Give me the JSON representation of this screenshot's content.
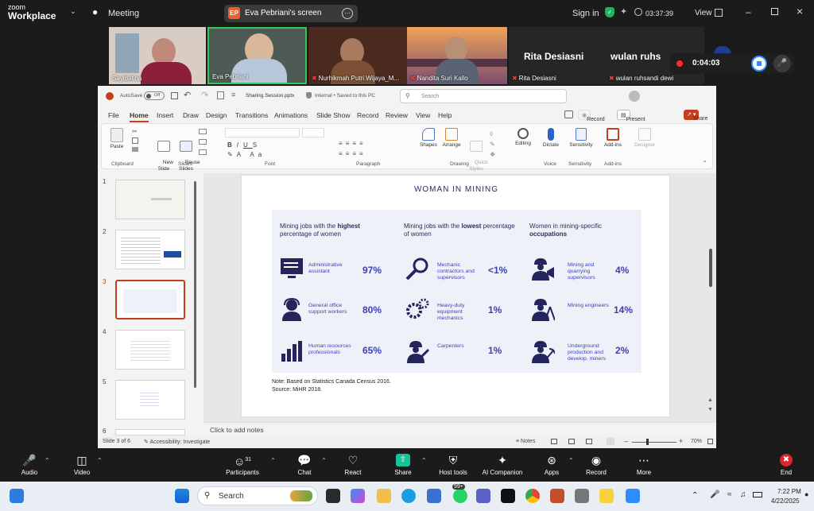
{
  "zoom": {
    "logo_line1": "zoom",
    "logo_line2": "Workplace",
    "meeting_label": "Meeting",
    "screen_badge": "EP",
    "screen_title": "Eva Pebriani's screen",
    "sign_in": "Sign in",
    "clock": "03:37:39",
    "view_label": "View",
    "recording_time": "0:04:03"
  },
  "participants": [
    {
      "name": "Sayidatina",
      "muted": false
    },
    {
      "name": "Eva Pebriani",
      "muted": false
    },
    {
      "name": "Nurhikmah Putri Wijaya_M...",
      "muted": true
    },
    {
      "name": "Nandita Suri Kallo",
      "muted": true
    },
    {
      "name": "Rita Desiasni",
      "muted": true,
      "big_label": "Rita Desiasni"
    },
    {
      "name": "wulan ruhsandi dewi",
      "muted": true,
      "big_label": "wulan  ruhs"
    }
  ],
  "ppt": {
    "autosave": "AutoSave",
    "autosave_state": "Off",
    "file_name": "Sharing Session.pptx",
    "file_status": "Internal • Saved to this PC",
    "search_placeholder": "Search",
    "menu": [
      "File",
      "Home",
      "Insert",
      "Draw",
      "Design",
      "Transitions",
      "Animations",
      "Slide Show",
      "Record",
      "Review",
      "View",
      "Help"
    ],
    "record_btn": "Record",
    "present_btn": "Present in Teams",
    "share_btn": "Share",
    "ribbon": {
      "paste": "Paste",
      "new_slide": "New\nSlide",
      "reuse_slides": "Reuse\nSlides",
      "shapes": "Shapes",
      "arrange": "Arrange",
      "quick_styles": "Quick\nStyles",
      "editing": "Editing",
      "dictate": "Dictate",
      "sensitivity": "Sensitivity",
      "add_ins": "Add-ins",
      "designer": "Designer",
      "groups": [
        "Clipboard",
        "Slides",
        "Font",
        "Paragraph",
        "Drawing",
        "Voice",
        "Sensitivity",
        "Add-ins"
      ]
    },
    "thumb_numbers": [
      "1",
      "2",
      "3",
      "4",
      "5",
      "6"
    ],
    "active_slide": 3,
    "notes_placeholder": "Click to add notes",
    "status_slide": "Slide 3 of 6",
    "status_accessibility": "Accessibility: Investigate",
    "status_notes": "Notes",
    "zoom_level": "70%"
  },
  "slide": {
    "title": "WOMAN IN MINING",
    "columns": [
      {
        "head_pre": "Mining jobs with the ",
        "head_bold": "highest",
        "head_post": " percentage of women",
        "rows": [
          {
            "label": "Administrative assistant",
            "value": "97%",
            "icon": "monitor-icon"
          },
          {
            "label": "General office support workers",
            "value": "80%",
            "icon": "headset-person-icon"
          },
          {
            "label": "Human resources professionals",
            "value": "65%",
            "icon": "bar-chart-icon"
          }
        ]
      },
      {
        "head_pre": "Mining jobs with the ",
        "head_bold": "lowest",
        "head_post": " percentage of women",
        "rows": [
          {
            "label": "Mechanic contractors and supervisors",
            "value": "<1%",
            "icon": "magnifier-icon"
          },
          {
            "label": "Heavy-duty equipment mechanics",
            "value": "1%",
            "icon": "gears-icon"
          },
          {
            "label": "Carpenters",
            "value": "1%",
            "icon": "carpenter-icon"
          }
        ]
      },
      {
        "head_pre": "Women in mining-specific ",
        "head_bold": "occupations",
        "head_post": "",
        "rows": [
          {
            "label": "Mining and quarrying supervisors",
            "value": "4%",
            "icon": "megaphone-worker-icon"
          },
          {
            "label": "Mining engineers",
            "value": "14%",
            "icon": "compass-worker-icon"
          },
          {
            "label": "Underground production and develop. miners",
            "value": "2%",
            "icon": "pickaxe-worker-icon"
          }
        ]
      }
    ],
    "note_line1": "Note: Based on Statistics Canada Census 2016.",
    "note_line2": "Source: MiHR 2018."
  },
  "toolbar": [
    {
      "label": "Audio",
      "icon": "mic-icon"
    },
    {
      "label": "Video",
      "icon": "camera-icon"
    },
    {
      "label": "Participants",
      "icon": "people-icon",
      "count": "31"
    },
    {
      "label": "Chat",
      "icon": "chat-icon"
    },
    {
      "label": "React",
      "icon": "heart-icon"
    },
    {
      "label": "Share",
      "icon": "share-icon"
    },
    {
      "label": "Host tools",
      "icon": "shield-icon"
    },
    {
      "label": "AI Companion",
      "icon": "sparkle-icon"
    },
    {
      "label": "Apps",
      "icon": "apps-icon"
    },
    {
      "label": "Record",
      "icon": "record-icon"
    },
    {
      "label": "More",
      "icon": "more-icon"
    },
    {
      "label": "End",
      "icon": "end-icon"
    }
  ],
  "taskbar": {
    "search_placeholder": "Search",
    "badge": "99+",
    "time": "7:22 PM",
    "date": "4/22/2025"
  },
  "colors": {
    "accent_navy": "#2b2d5a",
    "accent_blue": "#3d3fb5",
    "ppt_red": "#c43e1c",
    "zoom_green": "#15c39a"
  }
}
